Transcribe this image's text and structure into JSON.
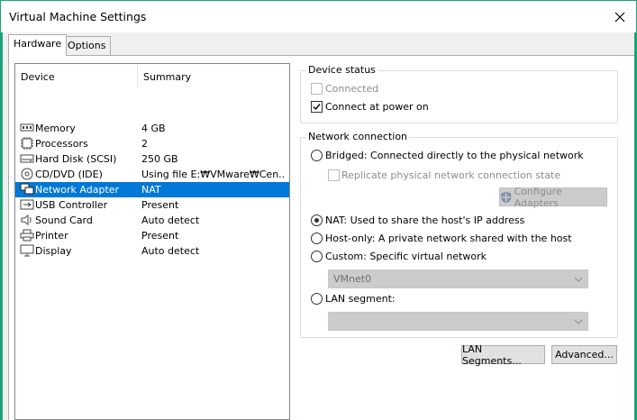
{
  "window": {
    "title": "Virtual Machine Settings"
  },
  "tabs": [
    {
      "label": "Hardware",
      "active": true
    },
    {
      "label": "Options",
      "active": false
    }
  ],
  "device_list": {
    "columns": [
      "Device",
      "Summary"
    ],
    "rows": [
      {
        "name": "Memory",
        "summary": "4 GB",
        "icon": "memory-icon"
      },
      {
        "name": "Processors",
        "summary": "2",
        "icon": "processor-icon"
      },
      {
        "name": "Hard Disk (SCSI)",
        "summary": "250 GB",
        "icon": "hard-disk-icon"
      },
      {
        "name": "CD/DVD (IDE)",
        "summary": "Using file E:₩VMware₩Cen...",
        "icon": "cd-dvd-icon"
      },
      {
        "name": "Network Adapter",
        "summary": "NAT",
        "icon": "network-adapter-icon",
        "selected": true
      },
      {
        "name": "USB Controller",
        "summary": "Present",
        "icon": "usb-icon"
      },
      {
        "name": "Sound Card",
        "summary": "Auto detect",
        "icon": "speaker-icon"
      },
      {
        "name": "Printer",
        "summary": "Present",
        "icon": "printer-icon"
      },
      {
        "name": "Display",
        "summary": "Auto detect",
        "icon": "display-icon"
      }
    ]
  },
  "device_status": {
    "title": "Device status",
    "connected_label": "Connected",
    "connected_checked": false,
    "connect_at_power_on_label": "Connect at power on",
    "connect_at_power_on_checked": true
  },
  "network_connection": {
    "title": "Network connection",
    "bridged_label": "Bridged: Connected directly to the physical network",
    "replicate_label": "Replicate physical network connection state",
    "configure_adapters_label": "Configure Adapters",
    "nat_label": "NAT: Used to share the host's IP address",
    "host_only_label": "Host-only: A private network shared with the host",
    "custom_label": "Custom: Specific virtual network",
    "custom_value": "VMnet0",
    "lan_segment_label": "LAN segment:",
    "lan_segment_value": "",
    "selected": "nat"
  },
  "buttons": {
    "lan_segments": "LAN Segments...",
    "advanced": "Advanced..."
  },
  "colors": {
    "accent": "#1aa37a",
    "selection": "#0078d7"
  }
}
